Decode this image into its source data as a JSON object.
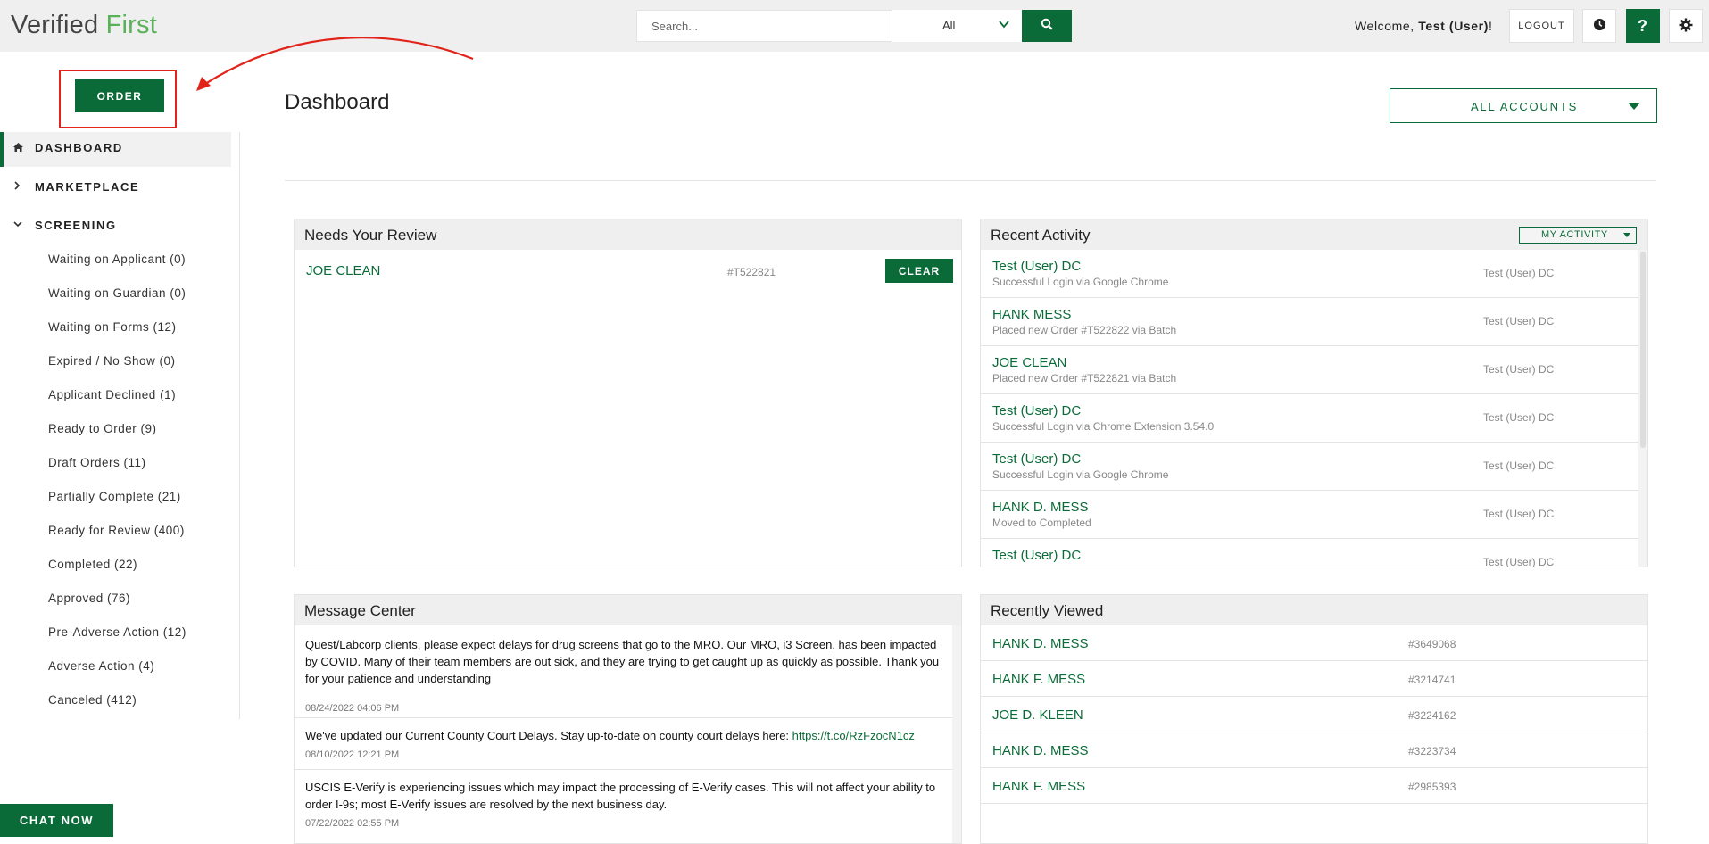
{
  "header": {
    "logo_part1": "Verified",
    "logo_part2": "First",
    "search_placeholder": "Search...",
    "filter_value": "All",
    "welcome_prefix": "Welcome,",
    "welcome_user": "Test (User)",
    "welcome_suffix": "!",
    "logout_label": "LOGOUT",
    "help_label": "?",
    "colors": {
      "brand_green": "#0b6b38",
      "logo_green": "#59b158",
      "annotation_red": "#e2231a"
    }
  },
  "sidebar": {
    "order_label": "ORDER",
    "dashboard_label": "DASHBOARD",
    "marketplace_label": "MARKETPLACE",
    "screening_label": "SCREENING",
    "screening_items": [
      "Waiting on Applicant (0)",
      "Waiting on Guardian (0)",
      "Waiting on Forms (12)",
      "Expired / No Show (0)",
      "Applicant Declined (1)",
      "Ready to Order (9)",
      "Draft Orders (11)",
      "Partially Complete (21)",
      "Ready for Review (400)",
      "Completed (22)",
      "Approved (76)",
      "Pre-Adverse Action (12)",
      "Adverse Action (4)",
      "Canceled (412)"
    ],
    "chat_label": "CHAT NOW"
  },
  "main": {
    "title": "Dashboard",
    "accounts_label": "ALL ACCOUNTS",
    "needs_review": {
      "title": "Needs Your Review",
      "items": [
        {
          "name": "JOE CLEAN",
          "id": "#T522821",
          "action": "CLEAR"
        }
      ]
    },
    "recent_activity": {
      "title": "Recent Activity",
      "filter_label": "MY ACTIVITY",
      "items": [
        {
          "name": "Test (User) DC",
          "detail": "Successful Login via Google Chrome",
          "user": "Test (User) DC"
        },
        {
          "name": "HANK MESS",
          "detail": "Placed new Order #T522822 via Batch",
          "user": "Test (User) DC"
        },
        {
          "name": "JOE CLEAN",
          "detail": "Placed new Order #T522821 via Batch",
          "user": "Test (User) DC"
        },
        {
          "name": "Test (User) DC",
          "detail": "Successful Login via Chrome Extension 3.54.0",
          "user": "Test (User) DC"
        },
        {
          "name": "Test (User) DC",
          "detail": "Successful Login via Google Chrome",
          "user": "Test (User) DC"
        },
        {
          "name": "HANK D. MESS",
          "detail": "Moved to Completed",
          "user": "Test (User) DC"
        },
        {
          "name": "Test (User) DC",
          "detail": "",
          "user": "Test (User) DC"
        }
      ]
    },
    "message_center": {
      "title": "Message Center",
      "messages": [
        {
          "text": "Quest/Labcorp clients, please expect delays for drug screens that go to the MRO. Our MRO, i3 Screen, has been impacted by COVID. Many of their team members are out sick, and they are trying to get caught up as quickly as possible. Thank you for your patience and understanding",
          "date": "08/24/2022 04:06 PM"
        },
        {
          "text": "We've updated our Current County Court Delays. Stay up-to-date on county court delays here: ",
          "link": "https://t.co/RzFzocN1cz",
          "date": "08/10/2022 12:21 PM"
        },
        {
          "text": "USCIS E-Verify is experiencing issues which may impact the processing of E-Verify cases. This will not affect your ability to order I-9s; most E-Verify issues are resolved by the next business day.",
          "date": "07/22/2022 02:55 PM"
        }
      ]
    },
    "recently_viewed": {
      "title": "Recently Viewed",
      "items": [
        {
          "name": "HANK D. MESS",
          "id": "#3649068"
        },
        {
          "name": "HANK F. MESS",
          "id": "#3214741"
        },
        {
          "name": "JOE D. KLEEN",
          "id": "#3224162"
        },
        {
          "name": "HANK D. MESS",
          "id": "#3223734"
        },
        {
          "name": "HANK F. MESS",
          "id": "#2985393"
        }
      ]
    }
  }
}
